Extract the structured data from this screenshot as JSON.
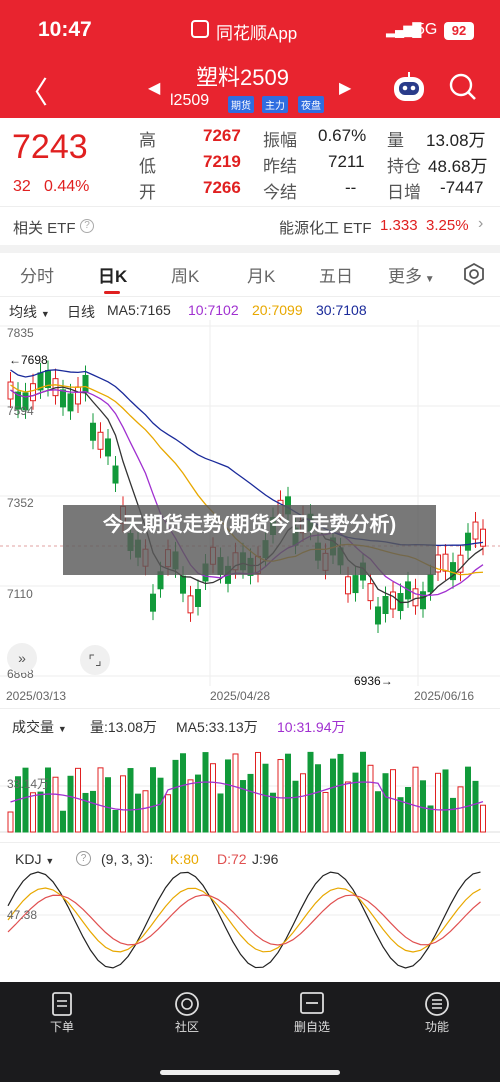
{
  "status_bar": {
    "time": "10:47",
    "app_name": "同花顺App",
    "network": "5G",
    "battery": "92"
  },
  "header": {
    "title": "塑料2509",
    "code": "l2509",
    "tags": [
      "期货",
      "主力",
      "夜盘"
    ]
  },
  "quote": {
    "price": "7243",
    "change": "32",
    "change_pct": "0.44%",
    "high_label": "高",
    "high": "7267",
    "low_label": "低",
    "low": "7219",
    "open_label": "开",
    "open": "7266",
    "amp_label": "振幅",
    "amp": "0.67%",
    "prev_label": "昨结",
    "prev": "7211",
    "settle_label": "今结",
    "settle": "--",
    "vol_label": "量",
    "vol": "13.08万",
    "oi_label": "持仓",
    "oi": "48.68万",
    "oi_chg_label": "日增",
    "oi_chg": "-7447"
  },
  "etf": {
    "label": "相关 ETF",
    "name": "能源化工 ETF",
    "price": "1.333",
    "pct": "3.25%"
  },
  "tabs": [
    "分时",
    "日K",
    "周K",
    "月K",
    "五日",
    "更多"
  ],
  "active_tab": "日K",
  "ma_bar": {
    "type": "均线",
    "period": "日线",
    "ma5": "MA5:7165",
    "ma10": "10:7102",
    "ma20": "20:7099",
    "ma30": "30:7108"
  },
  "kline": {
    "y_labels": [
      "7835",
      "7594",
      "7352",
      "7110",
      "6868"
    ],
    "high_mark": "←7698",
    "low_mark": "6936→",
    "dates": [
      "2025/03/13",
      "2025/04/28",
      "2025/06/16"
    ]
  },
  "volume": {
    "type": "成交量",
    "vol": "量:13.08万",
    "ma5": "MA5:33.13万",
    "ma10": "10:31.94万",
    "y_label": "33.14万"
  },
  "kdj": {
    "type": "KDJ",
    "params": "(9, 3, 3):",
    "k": "K:80",
    "d": "D:72",
    "j": "J:96",
    "y_label": "47.38"
  },
  "watermark": "今天期货走势(期货今日走势分析)",
  "bottom_nav": [
    "下单",
    "社区",
    "删自选",
    "功能"
  ],
  "colors": {
    "up": "#e02020",
    "down": "#119a3a",
    "header": "#e8242f",
    "ma5": "#333333",
    "ma10": "#a030d0",
    "ma20": "#e8a800",
    "ma30": "#1a2a9a"
  }
}
